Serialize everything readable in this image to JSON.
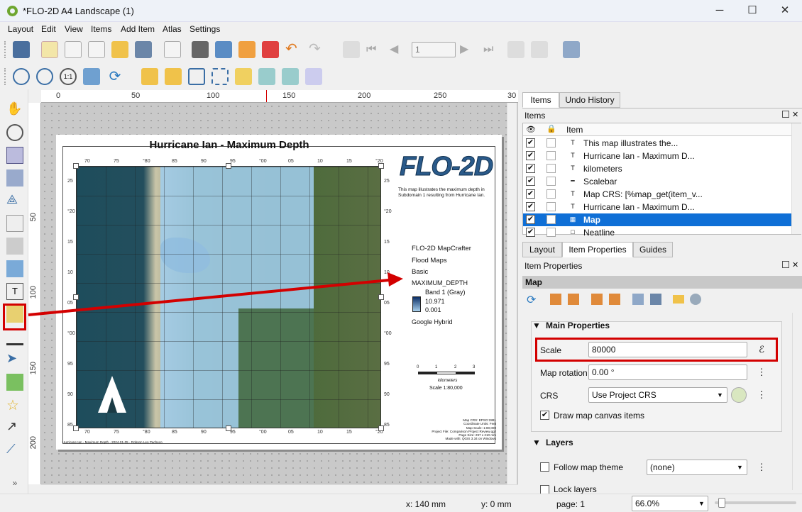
{
  "window": {
    "title": "*FLO-2D A4 Landscape (1)",
    "min": "─",
    "max": "☐",
    "close": "✕"
  },
  "menu": [
    "Layout",
    "Edit",
    "View",
    "Items",
    "Add Item",
    "Atlas",
    "Settings"
  ],
  "toolbar": {
    "page_number": "1"
  },
  "ruler": {
    "h_ticks": [
      "0",
      "50",
      "100",
      "150",
      "200",
      "250",
      "30"
    ],
    "v_ticks": [
      "50",
      "100",
      "150",
      "200"
    ]
  },
  "layout_page": {
    "title": "Hurricane Ian - Maximum Depth",
    "logo_text": "FLO-2D",
    "description": "This map illustrates the maximum depth in Subdomain 1 resulting from Hurricane Ian.",
    "legend": {
      "heading1": "FLO-2D MapCrafter",
      "heading2": "Flood Maps",
      "heading3": "Basic",
      "layer": "MAXIMUM_DEPTH",
      "band": "Band 1 (Gray)",
      "max": "10.971",
      "min": "0.001",
      "basemap": "Google Hybrid"
    },
    "scalebar": {
      "labels": [
        "0",
        "1",
        "2",
        "3"
      ],
      "unit": "kilometers",
      "scale_text": "Scale 1:80,000"
    },
    "meta": [
      "Map CRS: EPSG:2881",
      "Coordinate Units: Feet",
      "Map Scale: 1:80,000",
      "Project File: Comparison Project Review.qgz",
      "Page Size: 297 x 210 mm",
      "Made with: QGIS 3.34 on Windows"
    ],
    "footer": "Hurricane Ian - Maximum Depth - 2024-01-05 - Robson Leo Pacheco",
    "top_coords": [
      "70",
      "75",
      "°80",
      "85",
      "90",
      "95",
      "°00",
      "05",
      "10",
      "15",
      "°20"
    ],
    "side_coords": [
      "25",
      "°20",
      "15",
      "10",
      "05",
      "°00",
      "95",
      "90",
      "85"
    ]
  },
  "panel": {
    "tabs_top": [
      "Items",
      "Undo History"
    ],
    "items_label": "Items",
    "column_item": "Item",
    "items": [
      {
        "icon": "T",
        "label": "This map illustrates the...",
        "checked": "✔",
        "selected": false
      },
      {
        "icon": "T",
        "label": "Hurricane Ian - Maximum D...",
        "checked": "✔",
        "selected": false
      },
      {
        "icon": "T",
        "label": "kilometers",
        "checked": "✔",
        "selected": false
      },
      {
        "icon": "━",
        "label": "Scalebar",
        "checked": "✔",
        "selected": false
      },
      {
        "icon": "T",
        "label": "Map CRS: [%map_get(item_v...",
        "checked": "✔",
        "selected": false
      },
      {
        "icon": "T",
        "label": "Hurricane Ian - Maximum D...",
        "checked": "✔",
        "selected": false
      },
      {
        "icon": "▦",
        "label": "Map",
        "checked": "✔",
        "selected": true
      },
      {
        "icon": "□",
        "label": "Neatline",
        "checked": "✔",
        "selected": false
      }
    ],
    "tabs_bottom": [
      "Layout",
      "Item Properties",
      "Guides"
    ],
    "props_label": "Item Properties",
    "props_header": "Map",
    "main_properties": "Main Properties",
    "scale_label": "Scale",
    "scale_value": "80000",
    "rotation_label": "Map rotation",
    "rotation_value": "0.00 °",
    "crs_label": "CRS",
    "crs_value": "Use Project CRS",
    "draw_items_label": "Draw map canvas items",
    "draw_items_check": "✔",
    "layers_heading": "Layers",
    "follow_theme_label": "Follow map theme",
    "follow_theme_value": "(none)",
    "lock_layers_label": "Lock layers"
  },
  "status": {
    "x": "x: 140 mm",
    "y": "y: 0 mm",
    "page": "page: 1",
    "zoom": "66.0%"
  },
  "colors": {
    "accent_red": "#d30000",
    "selection_blue": "#0f6fd6"
  }
}
